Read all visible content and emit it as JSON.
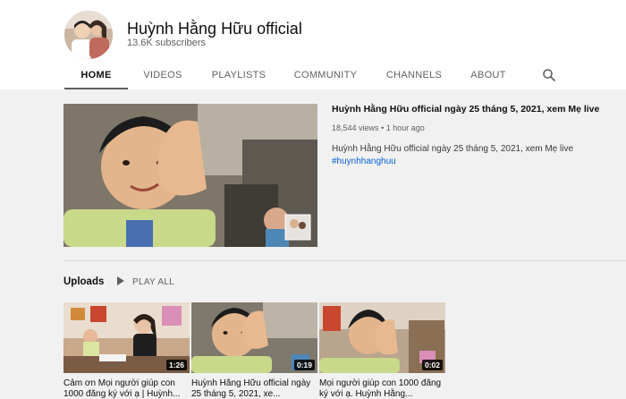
{
  "channel": {
    "name": "Huỳnh Hằng Hữu official",
    "subscribers": "13.6K subscribers"
  },
  "tabs": [
    {
      "label": "HOME",
      "active": true
    },
    {
      "label": "VIDEOS"
    },
    {
      "label": "PLAYLISTS"
    },
    {
      "label": "COMMUNITY"
    },
    {
      "label": "CHANNELS"
    },
    {
      "label": "ABOUT"
    }
  ],
  "search_icon": "search-icon",
  "featured": {
    "title": "Huỳnh Hằng Hữu official ngày 25 tháng 5, 2021, xem Mẹ live",
    "views": "18,544 views",
    "age": "1 hour ago",
    "description": "Huỳnh Hằng Hữu official ngày 25 tháng 5, 2021, xem Mẹ live",
    "hashtag": "#huynhhanghuu"
  },
  "uploads": {
    "title": "Uploads",
    "play_all": "PLAY ALL",
    "videos": [
      {
        "title": "Cảm ơn Mọi người giúp con 1000 đăng ký với ạ | Huỳnh...",
        "duration": "1:26"
      },
      {
        "title": "Huỳnh Hằng Hữu official ngày 25 tháng 5, 2021, xe...",
        "duration": "0:19"
      },
      {
        "title": "Mọi người giúp con 1000 đăng ký với ạ. Huỳnh Hằng...",
        "duration": "0:02"
      }
    ]
  },
  "colors": {
    "link": "#065fd4",
    "background": "#f1f1f1",
    "text_secondary": "#606060"
  }
}
